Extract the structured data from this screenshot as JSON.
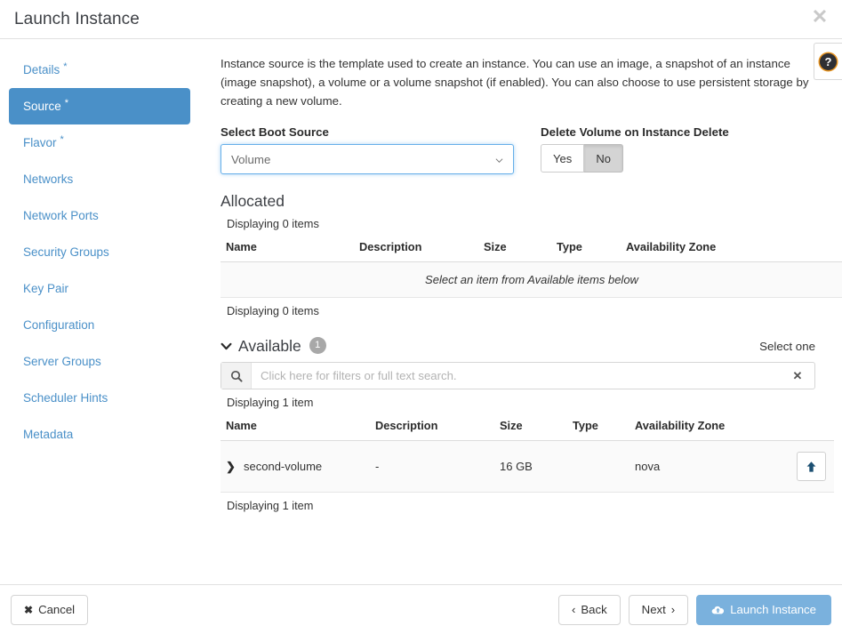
{
  "dialog": {
    "title": "Launch Instance",
    "close_icon": "close-icon",
    "help_icon": "help-icon",
    "help_glyph": "?"
  },
  "sidebar": {
    "items": [
      {
        "label": "Details",
        "required": true,
        "active": false
      },
      {
        "label": "Source",
        "required": true,
        "active": true
      },
      {
        "label": "Flavor",
        "required": true,
        "active": false
      },
      {
        "label": "Networks",
        "required": false,
        "active": false
      },
      {
        "label": "Network Ports",
        "required": false,
        "active": false
      },
      {
        "label": "Security Groups",
        "required": false,
        "active": false
      },
      {
        "label": "Key Pair",
        "required": false,
        "active": false
      },
      {
        "label": "Configuration",
        "required": false,
        "active": false
      },
      {
        "label": "Server Groups",
        "required": false,
        "active": false
      },
      {
        "label": "Scheduler Hints",
        "required": false,
        "active": false
      },
      {
        "label": "Metadata",
        "required": false,
        "active": false
      }
    ],
    "required_marker": "*"
  },
  "main": {
    "intro": "Instance source is the template used to create an instance. You can use an image, a snapshot of an instance (image snapshot), a volume or a volume snapshot (if enabled). You can also choose to use persistent storage by creating a new volume.",
    "boot_source": {
      "label": "Select Boot Source",
      "value": "Volume",
      "chevron_icon": "chevron-down-icon"
    },
    "delete_volume": {
      "label": "Delete Volume on Instance Delete",
      "yes_label": "Yes",
      "no_label": "No",
      "selected": "No"
    },
    "allocated": {
      "title": "Allocated",
      "count_top": "Displaying 0 items",
      "count_bottom": "Displaying 0 items",
      "columns": [
        "Name",
        "Description",
        "Size",
        "Type",
        "Availability Zone"
      ],
      "empty_message": "Select an item from Available items below",
      "rows": []
    },
    "available": {
      "title": "Available",
      "badge": "1",
      "caret_icon": "caret-down-icon",
      "select_hint": "Select one",
      "count_top": "Displaying 1 item",
      "count_bottom": "Displaying 1 item",
      "search": {
        "placeholder": "Click here for filters or full text search.",
        "value": "",
        "search_icon": "search-icon",
        "clear_icon": "clear-icon"
      },
      "columns": [
        "Name",
        "Description",
        "Size",
        "Type",
        "Availability Zone"
      ],
      "rows": [
        {
          "expand_icon": "chevron-right-icon",
          "name": "second-volume",
          "description": "-",
          "size": "16 GB",
          "type": "",
          "availability_zone": "nova",
          "action_icon": "arrow-up-icon"
        }
      ]
    }
  },
  "footer": {
    "cancel_label": "Cancel",
    "cancel_icon": "x-icon",
    "back_label": "Back",
    "back_icon": "chevron-left-icon",
    "next_label": "Next",
    "next_icon": "chevron-right-icon",
    "launch_label": "Launch Instance",
    "launch_icon": "cloud-upload-icon"
  },
  "colors": {
    "accent": "#4a90c8",
    "primary_button": "#7ab1dd",
    "badge": "#a8a8a8",
    "link": "#4a90c8"
  }
}
